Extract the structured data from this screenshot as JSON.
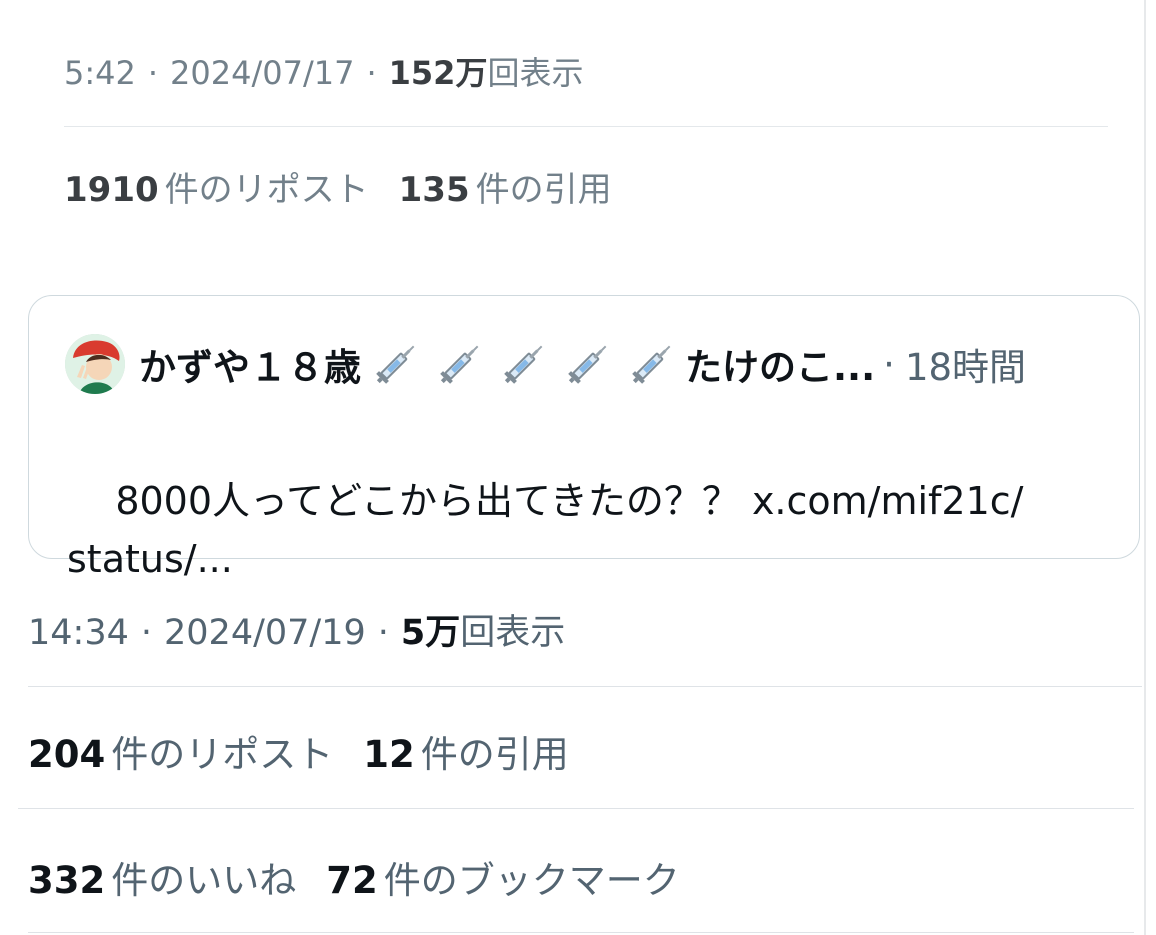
{
  "previous_post": {
    "time": "5:42",
    "date": "2024/07/17",
    "views_value": "152万",
    "views_label": "回表示",
    "reposts_value": "1910",
    "reposts_label": "件のリポスト",
    "quotes_value": "135",
    "quotes_label": "件の引用"
  },
  "quoted_post": {
    "author_name": "かずや１８歳",
    "syringe_icons": [
      "syringe-icon",
      "syringe-icon",
      "syringe-icon",
      "syringe-icon",
      "syringe-icon"
    ],
    "author_handle": "たけのこ...",
    "relative_time": "18時間",
    "text_main": "8000人ってどこから出てきたの？？ ",
    "text_link": "x.com/mif21c/\nstatus/..."
  },
  "current_post": {
    "time": "14:34",
    "date": "2024/07/19",
    "views_value": "5万",
    "views_label": "回表示",
    "reposts_value": "204",
    "reposts_label": "件のリポスト",
    "quotes_value": "12",
    "quotes_label": "件の引用",
    "likes_value": "332",
    "likes_label": "件のいいね",
    "bookmarks_value": "72",
    "bookmarks_label": "件のブックマーク"
  },
  "colors": {
    "text_primary": "#0f1419",
    "text_secondary": "#536471",
    "divider": "#dfe3e7",
    "card_border": "#cfd9de"
  }
}
